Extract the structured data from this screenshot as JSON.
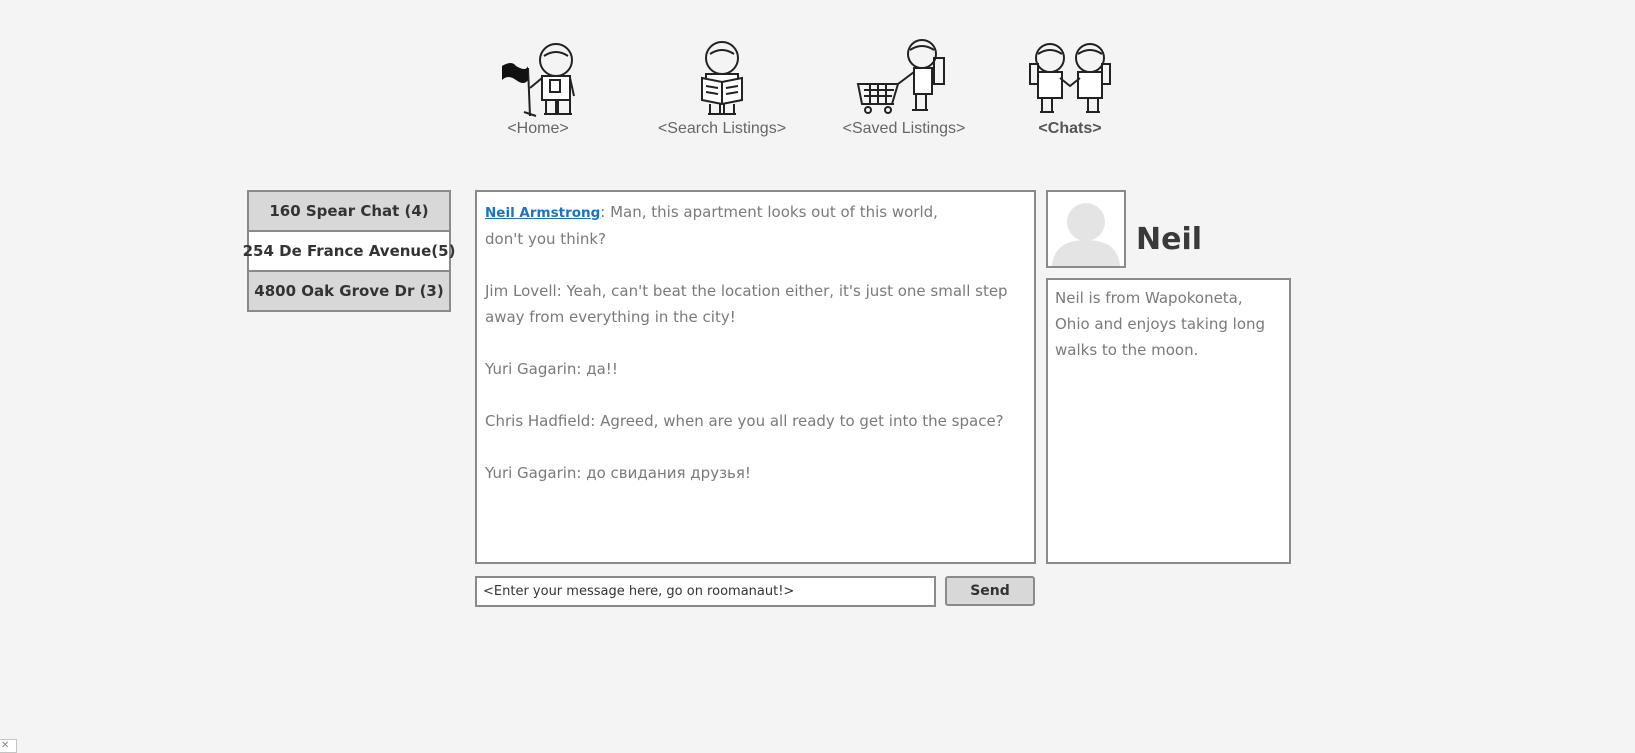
{
  "nav": {
    "items": [
      {
        "label": "<Home>",
        "icon": "astronaut-flag-icon"
      },
      {
        "label": "<Search Listings>",
        "icon": "astronaut-reading-icon"
      },
      {
        "label": "<Saved Listings>",
        "icon": "astronaut-cart-icon"
      },
      {
        "label": "<Chats>",
        "icon": "astronauts-handshake-icon",
        "active": true
      }
    ]
  },
  "chats": {
    "items": [
      {
        "label": "160 Spear Chat (4)"
      },
      {
        "label": "254 De France Avenue(5)",
        "active": true
      },
      {
        "label": "4800 Oak Grove Dr (3)"
      }
    ]
  },
  "conversation": {
    "messages": [
      {
        "author": "Neil Armstrong",
        "text": ": Man, this apartment looks out of this world,",
        "continued": "don't you think?"
      },
      {
        "text": "Jim Lovell: Yeah, can't beat the location either, it's just one small step away from everything in the city!"
      },
      {
        "text": "Yuri Gagarin: да!!"
      },
      {
        "text": "Chris Hadfield: Agreed, when are you all ready to get into the space?"
      },
      {
        "text": "Yuri Gagarin: до свидания друзья!"
      }
    ]
  },
  "compose": {
    "placeholder": "<Enter your message here, go on roomanaut!>",
    "send_label": "Send"
  },
  "profile": {
    "name": "Neil",
    "bio": "Neil is from Wapokoneta, Ohio and enjoys taking long walks to the moon."
  },
  "colors": {
    "background": "#f4f4f4",
    "border": "#8a8a8a",
    "tab_gray": "#d8d8d8",
    "link": "#1d73c2"
  }
}
